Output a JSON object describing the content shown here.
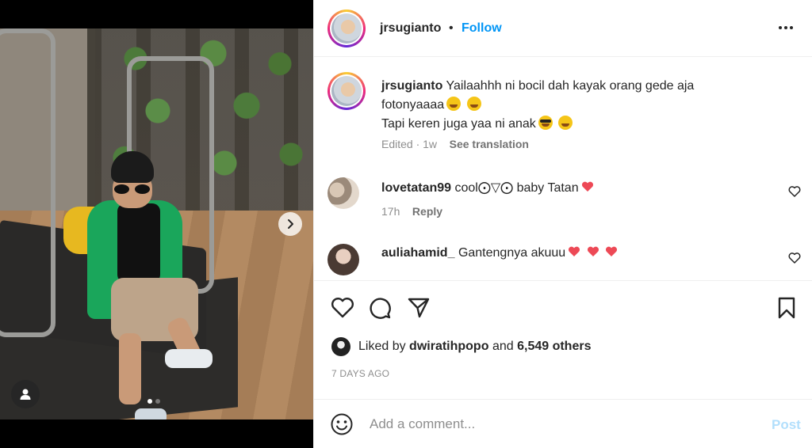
{
  "post": {
    "username": "jrsugianto",
    "dot": "•",
    "follow_label": "Follow",
    "caption_line1": "Yailaahhh ni bocil dah kayak orang gede aja",
    "caption_line2": "fotonyaaaa",
    "caption_line3": "Tapi keren juga yaa ni anak",
    "caption_meta_edited": "Edited · 1w",
    "caption_meta_translate": "See translation"
  },
  "comments": [
    {
      "username": "lovetatan99",
      "text": "cool⨀▽⨀ baby Tatan",
      "time": "17h",
      "reply_label": "Reply"
    },
    {
      "username": "auliahamid_",
      "text": "Gantengnya akuuu",
      "time": "",
      "reply_label": ""
    }
  ],
  "likes": {
    "prefix": "Liked by",
    "user": "dwiratihpopo",
    "conj": "and",
    "others": "6,549 others"
  },
  "timestamp": "7 DAYS AGO",
  "composer": {
    "placeholder": "Add a comment...",
    "post_label": "Post"
  },
  "colors": {
    "accent": "#0095f6",
    "post_disabled": "#b2dffc",
    "heart_red": "#ed4956",
    "text": "#262626",
    "muted": "#8e8e8e"
  },
  "carousel": {
    "total": 2,
    "active": 1
  }
}
